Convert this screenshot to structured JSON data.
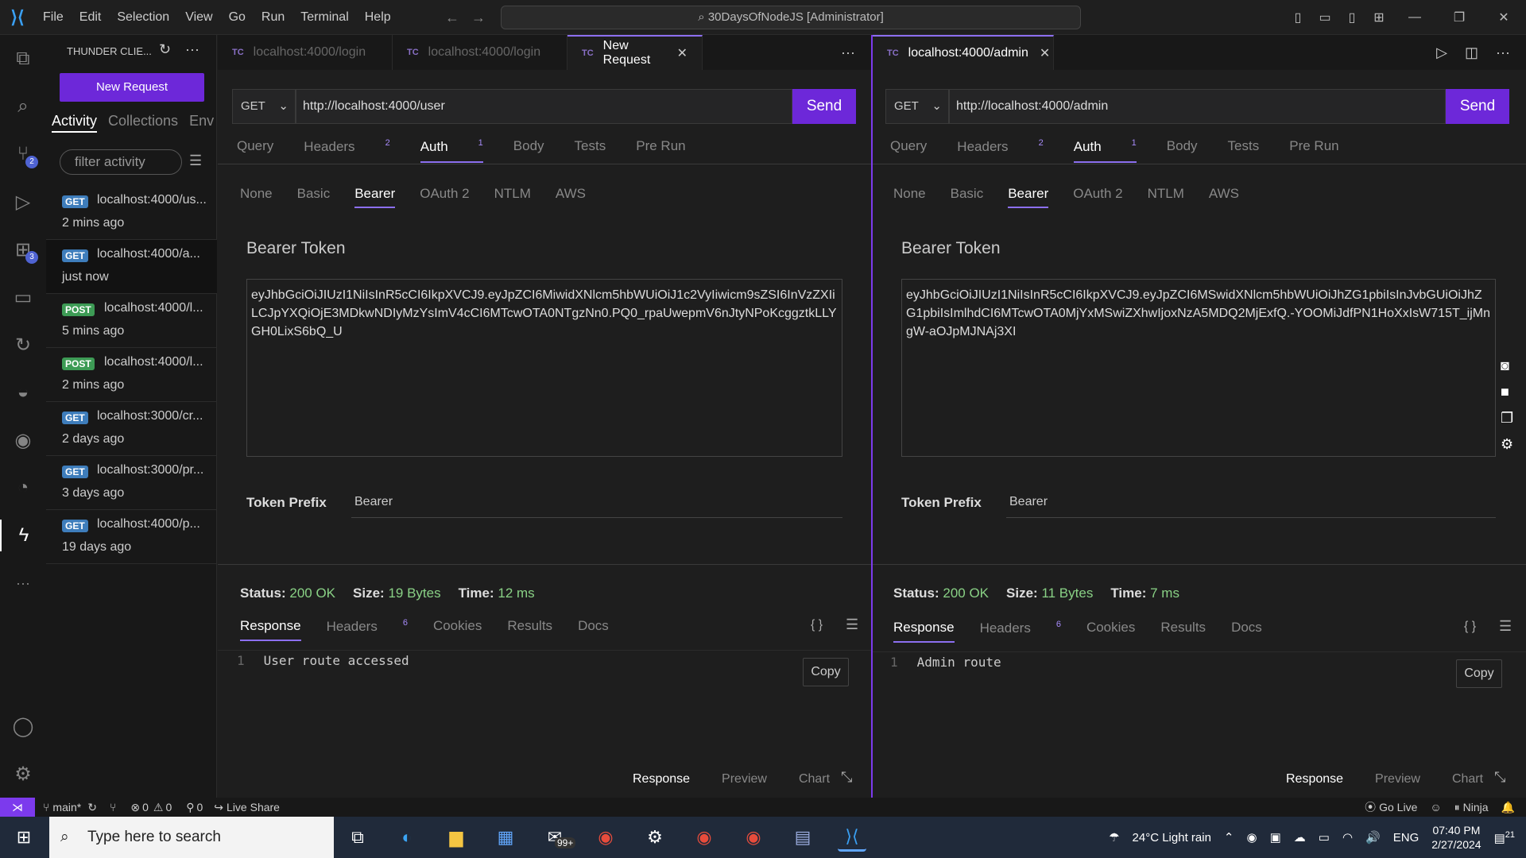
{
  "titlebar": {
    "menu": [
      "File",
      "Edit",
      "Selection",
      "View",
      "Go",
      "Run",
      "Terminal",
      "Help"
    ],
    "command_center": "30DaysOfNodeJS [Administrator]"
  },
  "sidebar": {
    "title": "THUNDER CLIE...",
    "new_request": "New Request",
    "tabs": [
      "Activity",
      "Collections",
      "Env"
    ],
    "filter_placeholder": "filter activity",
    "activity": [
      {
        "method": "GET",
        "url": "localhost:4000/us...",
        "time": "2 mins ago"
      },
      {
        "method": "GET",
        "url": "localhost:4000/a...",
        "time": "just now"
      },
      {
        "method": "POST",
        "url": "localhost:4000/l...",
        "time": "5 mins ago"
      },
      {
        "method": "POST",
        "url": "localhost:4000/l...",
        "time": "2 mins ago"
      },
      {
        "method": "GET",
        "url": "localhost:3000/cr...",
        "time": "2 days ago"
      },
      {
        "method": "GET",
        "url": "localhost:3000/pr...",
        "time": "3 days ago"
      },
      {
        "method": "GET",
        "url": "localhost:4000/p...",
        "time": "19 days ago"
      }
    ]
  },
  "activitybar": {
    "scm_badge": "2",
    "ext_badge": "3"
  },
  "left": {
    "tabs": [
      "localhost:4000/login",
      "localhost:4000/login",
      "New Request"
    ],
    "tc": "TC",
    "method": "GET",
    "url": "http://localhost:4000/user",
    "send": "Send",
    "subtabs": {
      "query": "Query",
      "headers": "Headers",
      "headers_count": "2",
      "auth": "Auth",
      "auth_count": "1",
      "body": "Body",
      "tests": "Tests",
      "prerun": "Pre Run"
    },
    "authtabs": [
      "None",
      "Basic",
      "Bearer",
      "OAuth 2",
      "NTLM",
      "AWS"
    ],
    "bearer_label": "Bearer Token",
    "token": "eyJhbGciOiJIUzI1NiIsInR5cCI6IkpXVCJ9.eyJpZCI6MiwidXNlcm5hbWUiOiJ1c2VyIiwicm9sZSI6InVzZXIiLCJpYXQiOjE3MDkwNDIyMzYsImV4cCI6MTcwOTA0NTgzNn0.PQ0_rpaUwepmV6nJtyNPoKcggztkLLYGH0LixS6bQ_U",
    "prefix_label": "Token Prefix",
    "prefix_value": "Bearer",
    "status_label": "Status:",
    "status": "200 OK",
    "size_label": "Size:",
    "size": "19 Bytes",
    "time_label": "Time:",
    "time": "12 ms",
    "resptabs": {
      "response": "Response",
      "headers": "Headers",
      "headers_count": "6",
      "cookies": "Cookies",
      "results": "Results",
      "docs": "Docs"
    },
    "line_no": "1",
    "body": "User route accessed",
    "copy": "Copy",
    "bottom": [
      "Response",
      "Preview",
      "Chart"
    ]
  },
  "right": {
    "tab": "localhost:4000/admin",
    "method": "GET",
    "url": "http://localhost:4000/admin",
    "send": "Send",
    "token": "eyJhbGciOiJIUzI1NiIsInR5cCI6IkpXVCJ9.eyJpZCI6MSwidXNlcm5hbWUiOiJhZG1pbiIsInJvbGUiOiJhZG1pbiIsImlhdCI6MTcwOTA0MjYxMSwiZXhwIjoxNzA5MDQ2MjExfQ.-YOOMiJdfPN1HoXxIsW715T_ijMngW-aOJpMJNAj3XI",
    "status": "200 OK",
    "size": "11 Bytes",
    "time": "7 ms",
    "line_no": "1",
    "body": "Admin route",
    "copy": "Copy"
  },
  "statusbar": {
    "branch": "main*",
    "problems": "0",
    "warnings": "0",
    "ports": "0",
    "live_share": "Live Share",
    "go_live": "Go Live",
    "ninja": "Ninja"
  },
  "taskbar": {
    "search_placeholder": "Type here to search",
    "mail_badge": "99+",
    "weather": "24°C  Light rain",
    "lang": "ENG",
    "time": "07:40 PM",
    "date": "2/27/2024",
    "notif": "21"
  }
}
